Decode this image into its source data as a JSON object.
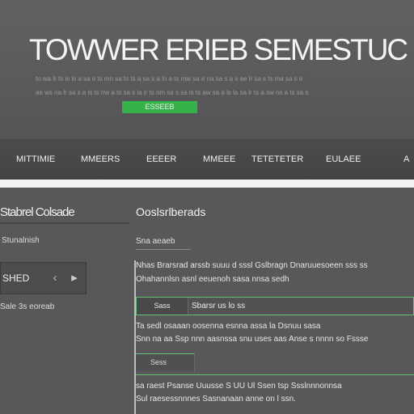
{
  "hero": {
    "title": "TOWWER ERIEB SEMESTUC",
    "line1": "to wa lr ts is ls a sa e ts mn sa ts ts a sa s a ln a ts mw sa e na sa s a s ae lr sa s ts ma sa s e",
    "line2": "ae ws na lr sa s a ls ts nw a ts sa s la lr ts nm sa s sa ls ts aw sa a ls la sa lr ts a sw ns a ts sa s",
    "cta_label": "ESSEEB"
  },
  "nav": {
    "items": [
      "MITTIMIE",
      "MMEERS",
      "EEEER",
      "MMEEE",
      "TETETETER",
      "EULAEE",
      "A"
    ]
  },
  "sidebar": {
    "title": "Stabrel Colsade",
    "label": "Stunalnish",
    "pager_label": "SHED",
    "prev_glyph": "‹",
    "next_glyph": "▸",
    "footer": "Sale 3s eoreab"
  },
  "main": {
    "title": "Ooslsrlberads",
    "subtitle": "Sna aeaeb",
    "para1": "Nhas Brarsrad arssb suuu d sssl Gslbragn Dnaruuesoeen sss ss",
    "para2": "Ohahannlsn asnl eeuenoh sasa nnsa sedh",
    "card1_button": "Sass",
    "card1_text": "Sbarsr us lo ss",
    "para3": "Ta sedl osaaan oosenna esnna assa la Dsnuu sasa",
    "para4": "Snn na aa Ssp nnn aasnssa snu uses aas Anse s nnnn so Fssse",
    "tab2_label": "Sess",
    "para5": "sa raest Psanse Uuusse S UU Ul Ssen tsp Ssslnnnonnsa",
    "para6": "Sul raesessnnnes Sasnanaan anne on l ssn."
  }
}
